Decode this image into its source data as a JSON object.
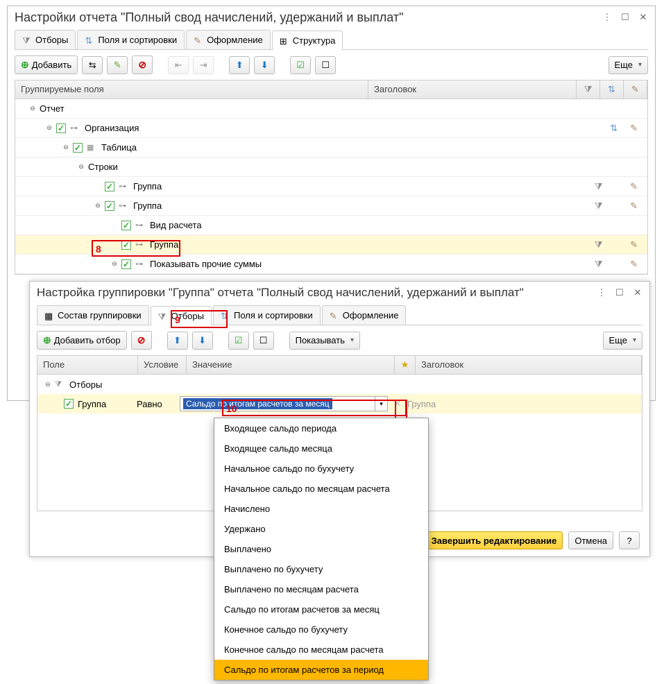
{
  "main": {
    "title": "Настройки отчета \"Полный свод начислений, удержаний и выплат\"",
    "tabs": {
      "otbory": "Отборы",
      "fields": "Поля и сортировки",
      "design": "Оформление",
      "structure": "Структура"
    },
    "toolbar": {
      "add": "Добавить",
      "more": "Еще"
    },
    "grid": {
      "col_fields": "Группируемые поля",
      "col_title": "Заголовок"
    },
    "tree": {
      "report": "Отчет",
      "org": "Организация",
      "table": "Таблица",
      "rows": "Строки",
      "group1": "Группа",
      "group2": "Группа",
      "calc_type": "Вид расчета",
      "group3": "Группа",
      "other_sums": "Показывать прочие суммы"
    },
    "annot8": "8"
  },
  "modal": {
    "title": "Настройка группировки \"Группа\" отчета \"Полный свод начислений, удержаний и выплат\"",
    "tabs": {
      "composition": "Состав группировки",
      "filters": "Отборы",
      "fields": "Поля и сортировки",
      "design": "Оформление"
    },
    "toolbar": {
      "add_filter": "Добавить отбор",
      "show": "Показывать",
      "more": "Еще"
    },
    "grid": {
      "col_field": "Поле",
      "col_cond": "Условие",
      "col_value": "Значение",
      "col_star": "★",
      "col_title": "Заголовок"
    },
    "filters_root": "Отборы",
    "filter_row": {
      "field": "Группа",
      "cond": "Равно",
      "value": "Сальдо по итогам расчетов за месяц",
      "title": "Группа"
    },
    "annot9": "9",
    "annot10": "10",
    "dropdown": [
      "Входящее сальдо периода",
      "Входящее сальдо месяца",
      "Начальное сальдо по бухучету",
      "Начальное сальдо по месяцам расчета",
      "Начислено",
      "Удержано",
      "Выплачено",
      "Выплачено по бухучету",
      "Выплачено по месяцам расчета",
      "Сальдо по итогам расчетов за месяц",
      "Конечное сальдо по бухучету",
      "Конечное сальдо по месяцам расчета",
      "Сальдо по итогам расчетов за период"
    ],
    "buttons": {
      "finish": "Завершить редактирование",
      "cancel": "Отмена",
      "help": "?"
    }
  }
}
